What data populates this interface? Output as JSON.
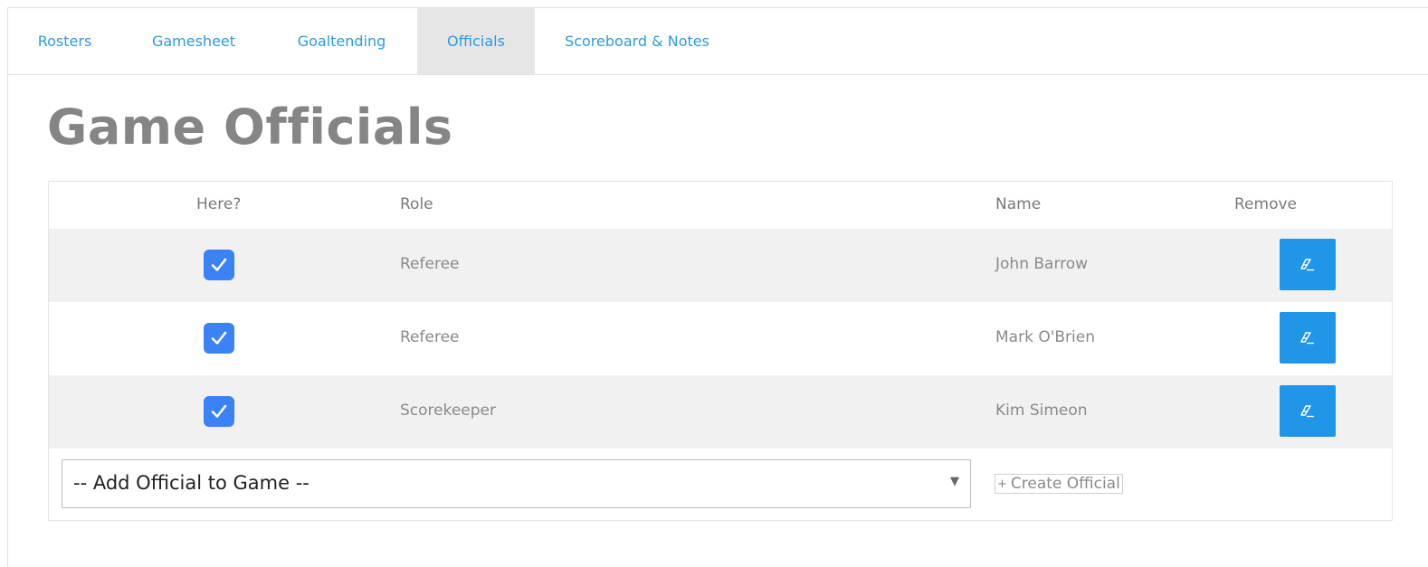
{
  "tabs": [
    {
      "label": "Rosters",
      "active": false
    },
    {
      "label": "Gamesheet",
      "active": false
    },
    {
      "label": "Goaltending",
      "active": false
    },
    {
      "label": "Officials",
      "active": true
    },
    {
      "label": "Scoreboard & Notes",
      "active": false
    }
  ],
  "page": {
    "title": "Game Officials"
  },
  "table": {
    "headers": {
      "here": "Here?",
      "role": "Role",
      "name": "Name",
      "remove": "Remove"
    },
    "rows": [
      {
        "here": true,
        "role": "Referee",
        "name": "John Barrow",
        "remove_icon": "eraser-icon"
      },
      {
        "here": true,
        "role": "Referee",
        "name": "Mark O'Brien",
        "remove_icon": "eraser-icon"
      },
      {
        "here": true,
        "role": "Scorekeeper",
        "name": "Kim Simeon",
        "remove_icon": "eraser-icon"
      }
    ]
  },
  "add_official": {
    "selected": "-- Add Official to Game --"
  },
  "create_official": {
    "plus": "+",
    "label": "Create Official"
  },
  "colors": {
    "accent": "#2196e8",
    "checkbox": "#3b82f6",
    "tab_text": "#2b9be0",
    "active_tab_bg": "#e6e6e6",
    "title": "#858585",
    "row_shade": "#f1f1f1"
  }
}
